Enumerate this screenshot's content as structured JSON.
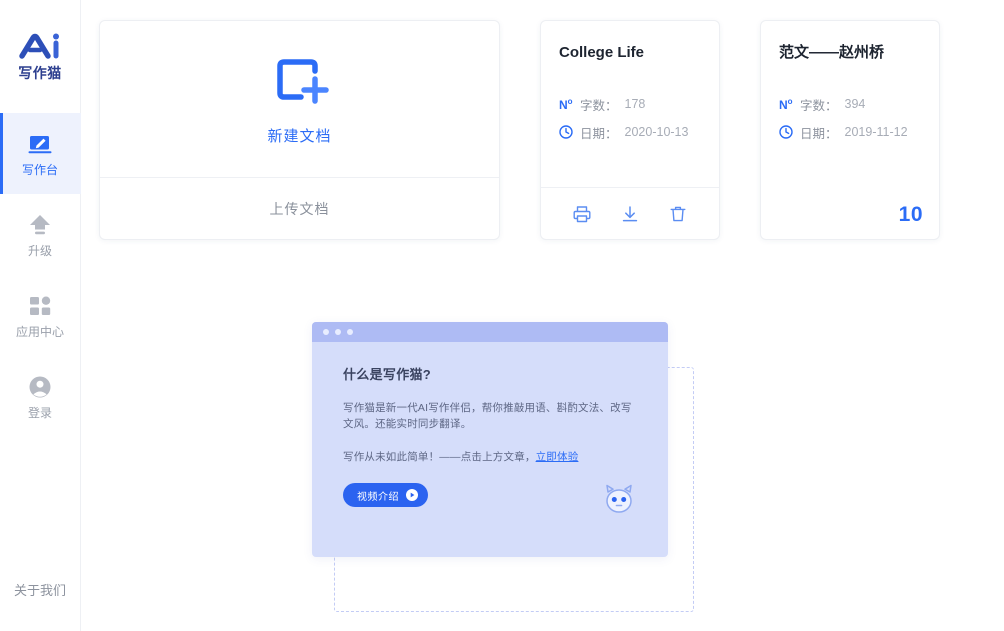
{
  "sidebar": {
    "logo": {
      "mark": "ai-logo-icon",
      "text": "写作猫"
    },
    "items": [
      {
        "label": "写作台",
        "icon": "writing-desk-icon",
        "active": true
      },
      {
        "label": "升级",
        "icon": "upgrade-arrow-icon",
        "active": false
      },
      {
        "label": "应用中心",
        "icon": "app-grid-icon",
        "active": false
      },
      {
        "label": "登录",
        "icon": "user-avatar-icon",
        "active": false
      }
    ],
    "about_label": "关于我们"
  },
  "new_doc_card": {
    "icon": "new-document-plus-icon",
    "create_label": "新建文档",
    "upload_label": "上传文档"
  },
  "documents": [
    {
      "title": "College Life",
      "wordcount_icon": "number-sign-icon",
      "wordcount_label": "字数：",
      "wordcount_value": "178",
      "date_icon": "clock-icon",
      "date_label": "日期：",
      "date_value": "2020-10-13",
      "actions": [
        {
          "name": "print-icon",
          "label": "打印"
        },
        {
          "name": "download-icon",
          "label": "下载"
        },
        {
          "name": "trash-icon",
          "label": "删除"
        }
      ],
      "count_badge": ""
    },
    {
      "title": "范文——赵州桥",
      "wordcount_icon": "number-sign-icon",
      "wordcount_label": "字数：",
      "wordcount_value": "394",
      "date_icon": "clock-icon",
      "date_label": "日期：",
      "date_value": "2019-11-12",
      "actions": [],
      "count_badge": "10"
    }
  ],
  "promo": {
    "heading": "什么是写作猫?",
    "paragraph": "写作猫是新一代AI写作伴侣，帮你推敲用语、斟酌文法、改写文风。还能实时同步翻译。",
    "cta_text": "写作从未如此简单！——点击上方文章，",
    "cta_link": "立即体验",
    "button_label": "视频介绍",
    "button_icon": "play-circle-icon",
    "mascot_icon": "cat-mascot-icon"
  },
  "colors": {
    "accent": "#2b6cf6",
    "promo_bg": "#d5ddfa",
    "promo_titlebar": "#aebbf4",
    "button_blue": "#2b63f0",
    "muted_text": "#a7acb6"
  }
}
